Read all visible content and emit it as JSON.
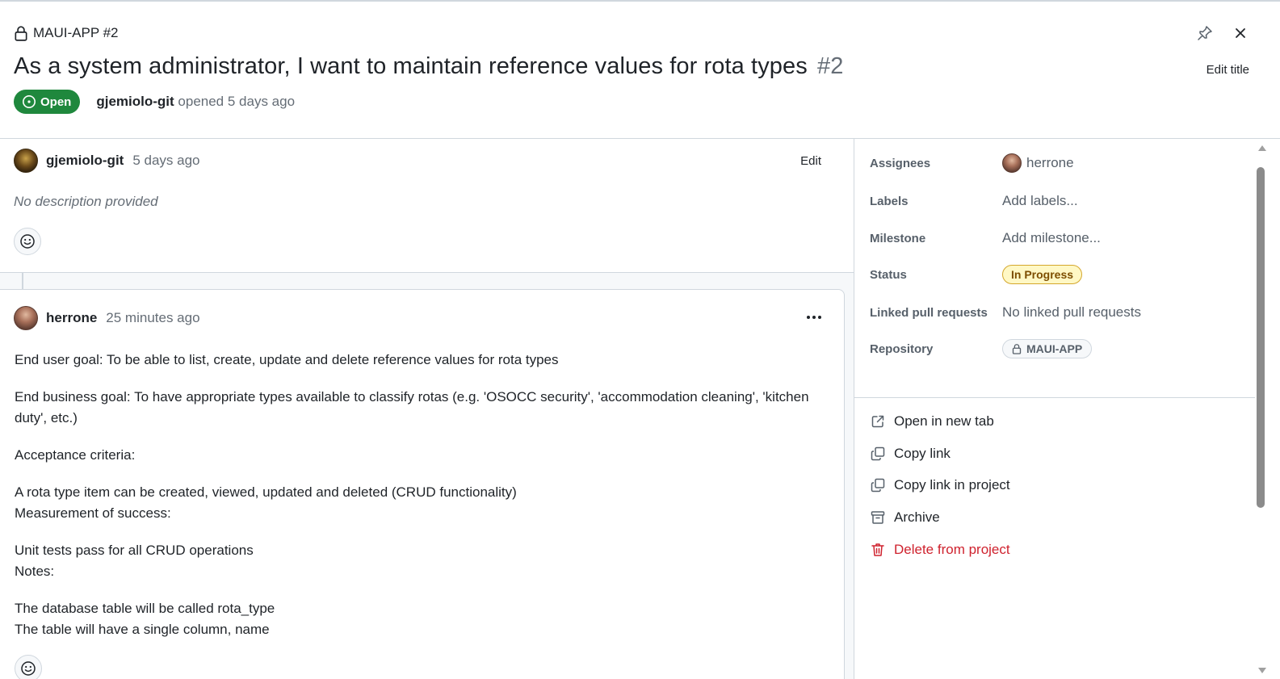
{
  "header": {
    "repo_ref": "MAUI-APP #2",
    "title": "As a system administrator, I want to maintain reference values for rota types",
    "number": "#2",
    "edit_title_label": "Edit title",
    "state_label": "Open",
    "opened_by": "gjemiolo-git",
    "opened_text": "opened 5 days ago"
  },
  "issue_body": {
    "author": "gjemiolo-git",
    "time": "5 days ago",
    "edit_label": "Edit",
    "description": "No description provided"
  },
  "comment": {
    "author": "herrone",
    "time": "25 minutes ago",
    "paragraphs": [
      "End user goal: To be able to list, create, update and delete reference values for rota types",
      "End business goal: To have appropriate types available to classify rotas (e.g. 'OSOCC security', 'accommodation cleaning', 'kitchen duty', etc.)",
      "Acceptance criteria:",
      "A rota type item can be created, viewed, updated and deleted (CRUD functionality)",
      "Measurement of success:",
      "Unit tests pass for all CRUD operations",
      "Notes:",
      "The database table will be called rota_type",
      "The table will have a single column, name"
    ]
  },
  "sidebar": {
    "assignees_label": "Assignees",
    "assignee_name": "herrone",
    "labels_label": "Labels",
    "labels_value": "Add labels...",
    "milestone_label": "Milestone",
    "milestone_value": "Add milestone...",
    "status_label": "Status",
    "status_value": "In Progress",
    "linked_pr_label": "Linked pull requests",
    "linked_pr_value": "No linked pull requests",
    "repository_label": "Repository",
    "repository_value": "MAUI-APP",
    "actions": {
      "open_new_tab": "Open in new tab",
      "copy_link": "Copy link",
      "copy_link_project": "Copy link in project",
      "archive": "Archive",
      "delete": "Delete from project"
    }
  },
  "colors": {
    "open_green": "#1f883d",
    "danger_red": "#cf222e",
    "status_yellow_bg": "#fff8c5",
    "muted_text": "#656d76"
  },
  "icons": [
    "lock-icon",
    "issue-open-icon",
    "pin-icon",
    "close-icon",
    "smiley-icon",
    "kebab-icon",
    "link-external-icon",
    "copy-icon",
    "archive-icon",
    "trash-icon"
  ]
}
